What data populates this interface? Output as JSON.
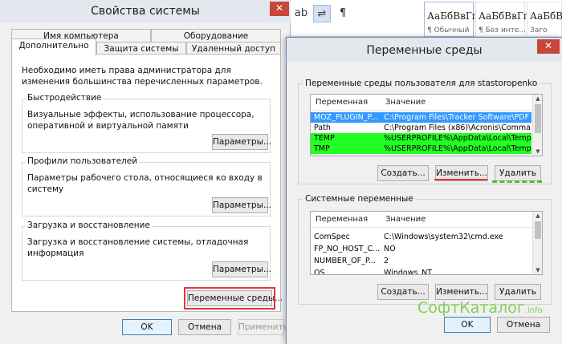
{
  "ribbon": {
    "tools": [
      "ab",
      "⇌",
      "¶"
    ],
    "styles": [
      {
        "sample": "АаБбВвГг,",
        "name": "¶ Обычный"
      },
      {
        "sample": "АаБбВвГг,",
        "name": "¶ Без инте..."
      },
      {
        "sample": "АаБбВ",
        "name": "Заго"
      }
    ]
  },
  "left": {
    "title": "Свойства системы",
    "close_glyph": "✕",
    "tabs_row1": [
      "Имя компьютера",
      "Оборудование"
    ],
    "tabs_row2": [
      "Дополнительно",
      "Защита системы",
      "Удаленный доступ"
    ],
    "note": "Необходимо иметь права администратора для изменения большинства перечисленных параметров.",
    "groups": [
      {
        "title": "Быстродействие",
        "text": "Визуальные эффекты, использование процессора, оперативной и виртуальной памяти",
        "button": "Параметры..."
      },
      {
        "title": "Профили пользователей",
        "text": "Параметры рабочего стола, относящиеся ко входу в систему",
        "button": "Параметры..."
      },
      {
        "title": "Загрузка и восстановление",
        "text": "Загрузка и восстановление системы, отладочная информация",
        "button": "Параметры..."
      }
    ],
    "env_button": "Переменные среды...",
    "footer": {
      "ok": "OK",
      "cancel": "Отмена",
      "apply": "Применить"
    }
  },
  "right": {
    "title": "Переменные среды",
    "close_glyph": "✕",
    "user_section": "Переменные среды пользователя для stastoropenko",
    "col_var": "Переменная",
    "col_val": "Значение",
    "user_rows": [
      {
        "name": "MOZ_PLUGIN_P...",
        "value": "C:\\Program Files\\Tracker Software\\PDF ..."
      },
      {
        "name": "Path",
        "value": "C:\\Program Files (x86)\\Acronis\\Comman..."
      },
      {
        "name": "TEMP",
        "value": "%USERPROFILE%\\AppData\\Local\\Temp"
      },
      {
        "name": "TMP",
        "value": "%USERPROFILE%\\AppData\\Local\\Temp"
      }
    ],
    "user_buttons": {
      "create": "Создать...",
      "edit": "Изменить...",
      "delete": "Удалить"
    },
    "sys_section": "Системные переменные",
    "sys_rows": [
      {
        "name": "ComSpec",
        "value": "C:\\Windows\\system32\\cmd.exe"
      },
      {
        "name": "FP_NO_HOST_C...",
        "value": "NO"
      },
      {
        "name": "NUMBER_OF_P...",
        "value": "2"
      },
      {
        "name": "OS",
        "value": "Windows_NT"
      }
    ],
    "sys_buttons": {
      "create": "Создать...",
      "edit": "Изменить...",
      "delete": "Удалить"
    },
    "footer": {
      "ok": "OK",
      "cancel": "Отмена"
    }
  },
  "watermark": {
    "main": "СофтКаталог",
    "suffix": ".info"
  }
}
